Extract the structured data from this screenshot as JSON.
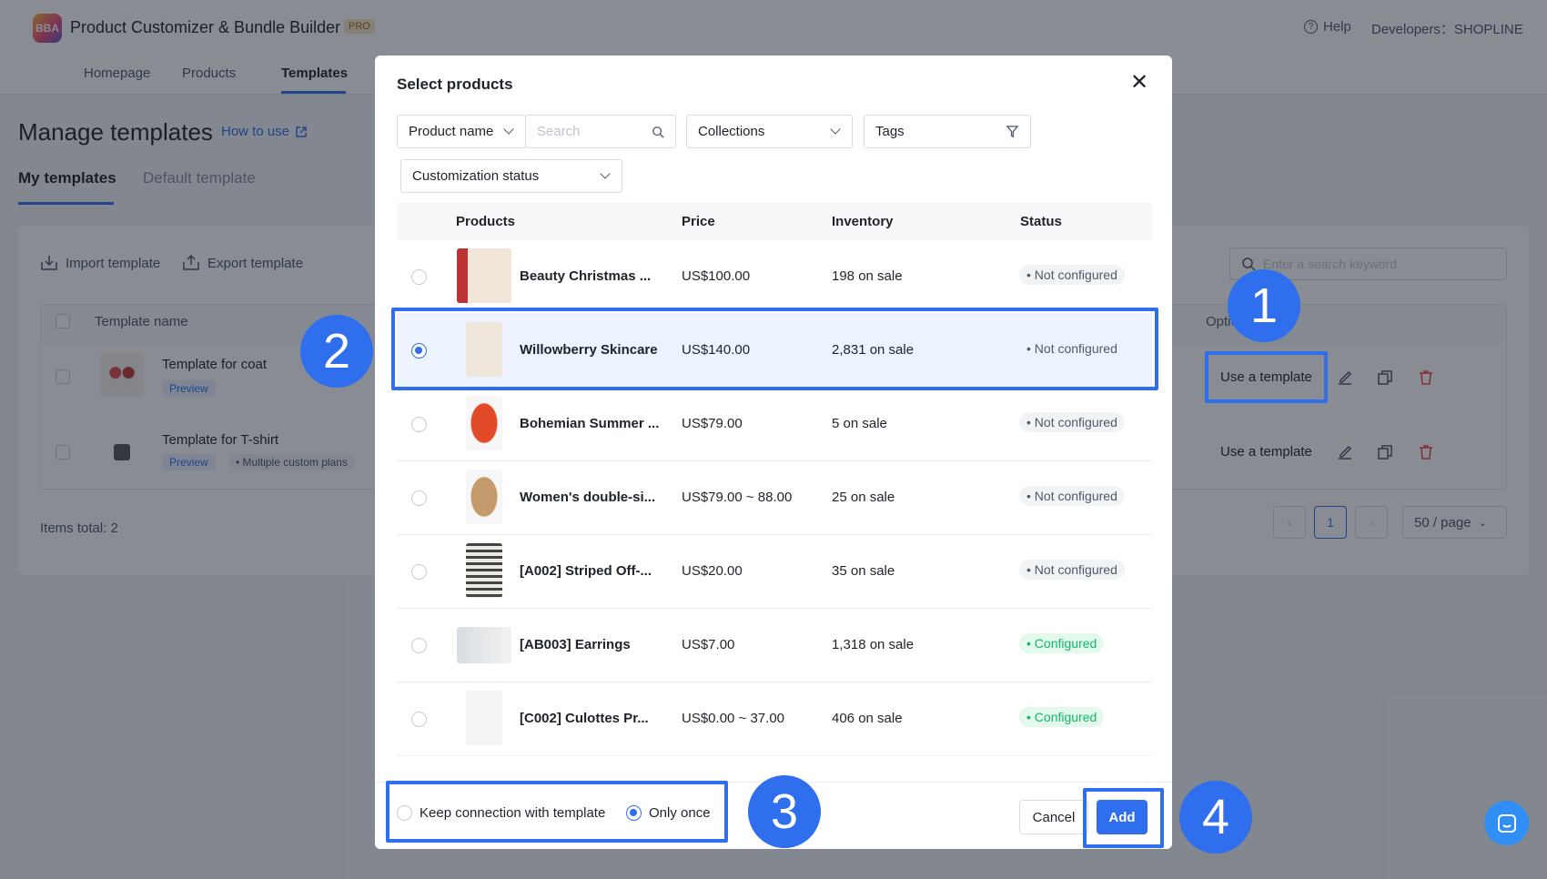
{
  "app": {
    "title": "Product Customizer & Bundle Builder",
    "badge": "PRO",
    "logo_text": "BBA",
    "help": "Help",
    "developers": "Developers：SHOPLINE"
  },
  "nav": {
    "tabs": [
      "Homepage",
      "Products",
      "Templates"
    ],
    "active": "Templates"
  },
  "page": {
    "title": "Manage templates",
    "how_to_use": "How to use",
    "subtabs": [
      "My templates",
      "Default template"
    ]
  },
  "toolbar": {
    "import": "Import template",
    "export": "Export template",
    "search_placeholder": "Enter a search keyword"
  },
  "templates_table": {
    "col_name": "Template name",
    "col_options": "Optic",
    "rows": [
      {
        "name": "Template for coat",
        "preview": "Preview",
        "plans": "",
        "use": "Use a template"
      },
      {
        "name": "Template for T-shirt",
        "preview": "Preview",
        "plans": "• Multiple custom plans",
        "use": "Use a template"
      }
    ],
    "total": "Items total: 2"
  },
  "pagination": {
    "current": "1",
    "page_size": "50 / page"
  },
  "modal": {
    "title": "Select products",
    "filters": {
      "product_name": "Product name",
      "search_placeholder": "Search",
      "collections": "Collections",
      "tags": "Tags",
      "customization_status": "Customization status"
    },
    "columns": [
      "Products",
      "Price",
      "Inventory",
      "Status"
    ],
    "rows": [
      {
        "name": "Beauty Christmas ...",
        "price": "US$100.00",
        "inventory": "198 on sale",
        "status": "Not configured",
        "selected": false
      },
      {
        "name": "Willowberry Skincare",
        "price": "US$140.00",
        "inventory": "2,831 on sale",
        "status": "Not configured",
        "selected": true
      },
      {
        "name": "Bohemian Summer ...",
        "price": "US$79.00",
        "inventory": "5 on sale",
        "status": "Not configured",
        "selected": false
      },
      {
        "name": "Women's double-si...",
        "price": "US$79.00 ~ 88.00",
        "inventory": "25 on sale",
        "status": "Not configured",
        "selected": false
      },
      {
        "name": "[A002] Striped Off-...",
        "price": "US$20.00",
        "inventory": "35 on sale",
        "status": "Not configured",
        "selected": false
      },
      {
        "name": "[AB003] Earrings",
        "price": "US$7.00",
        "inventory": "1,318 on sale",
        "status": "Configured",
        "selected": false
      },
      {
        "name": "[C002] Culottes Pr...",
        "price": "US$0.00 ~ 37.00",
        "inventory": "406 on sale",
        "status": "Configured",
        "selected": false
      }
    ],
    "footer": {
      "keep_connection": "Keep connection with template",
      "only_once": "Only once",
      "cancel": "Cancel",
      "add": "Add"
    }
  },
  "callouts": [
    "1",
    "2",
    "3",
    "4"
  ],
  "colors": {
    "accent": "#2f6fed",
    "success": "#14b86b",
    "danger": "#f53f3f"
  }
}
